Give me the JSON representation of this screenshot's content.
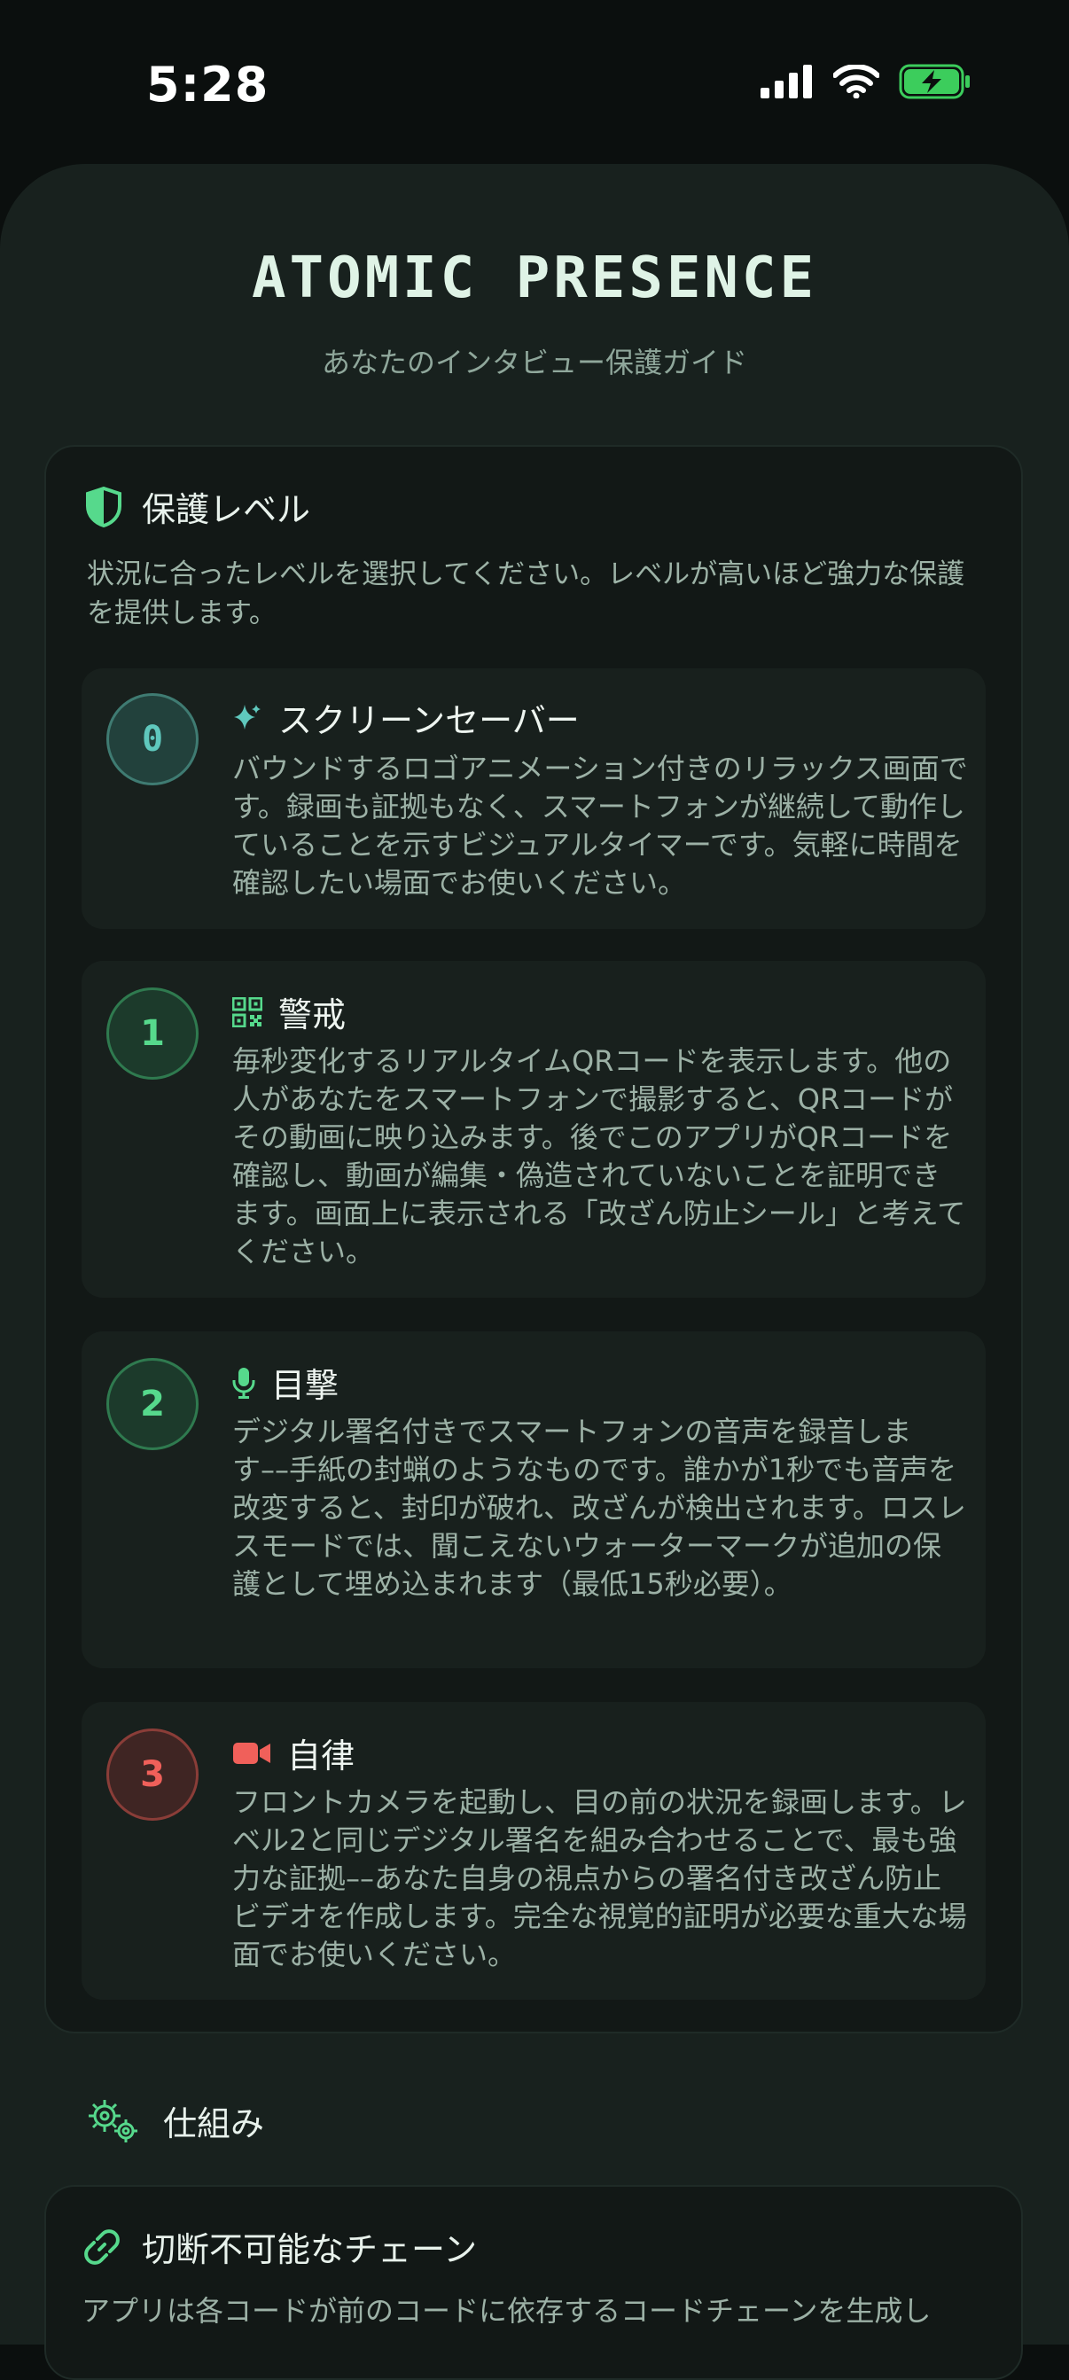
{
  "status_bar": {
    "time": "5:28"
  },
  "header": {
    "title": "ATOMIC PRESENCE",
    "subtitle": "あなたのインタビュー保護ガイド"
  },
  "protection": {
    "title": "保護レベル",
    "description": "状況に合ったレベルを選択してください。レベルが高いほど強力な保護を提供します。",
    "levels": [
      {
        "number": "0",
        "icon": "sparkle-icon",
        "title": "スクリーンセーバー",
        "description": "バウンドするロゴアニメーション付きのリラックス画面です。録画も証拠もなく、スマートフォンが継続して動作していることを示すビジュアルタイマーです。気軽に時間を確認したい場面でお使いください。",
        "color": "#5fc8bd"
      },
      {
        "number": "1",
        "icon": "qr-code-icon",
        "title": "警戒",
        "description": "毎秒変化するリアルタイムQRコードを表示します。他の人があなたをスマートフォンで撮影すると、QRコードがその動画に映り込みます。後でこのアプリがQRコードを確認し、動画が編集・偽造されていないことを証明できます。画面上に表示される「改ざん防止シール」と考えてください。",
        "color": "#56d98c"
      },
      {
        "number": "2",
        "icon": "microphone-icon",
        "title": "目撃",
        "description": "デジタル署名付きでスマートフォンの音声を録音します––手紙の封蝋のようなものです。誰かが1秒でも音声を改変すると、封印が破れ、改ざんが検出されます。ロスレスモードでは、聞こえないウォーターマークが追加の保護として埋め込まれます（最低15秒必要）。",
        "color": "#56d98c"
      },
      {
        "number": "3",
        "icon": "video-camera-icon",
        "title": "自律",
        "description": "フロントカメラを起動し、目の前の状況を録画します。レベル2と同じデジタル署名を組み合わせることで、最も強力な証拠––あなた自身の視点からの署名付き改ざん防止ビデオを作成します。完全な視覚的証明が必要な重大な場面でお使いください。",
        "color": "#f0605a"
      }
    ]
  },
  "how_it_works": {
    "title": "仕組み",
    "icon": "gears-icon"
  },
  "chain": {
    "icon": "link-icon",
    "title": "切断不可能なチェーン",
    "description": "アプリは各コードが前のコードに依存するコードチェーンを生成し"
  },
  "colors": {
    "background": "#0b0f0e",
    "sheet": "#18211e",
    "panel": "#121816",
    "card": "#18201d",
    "accent_green": "#56d98c",
    "accent_teal": "#5fc8bd",
    "accent_red": "#f0605a"
  }
}
